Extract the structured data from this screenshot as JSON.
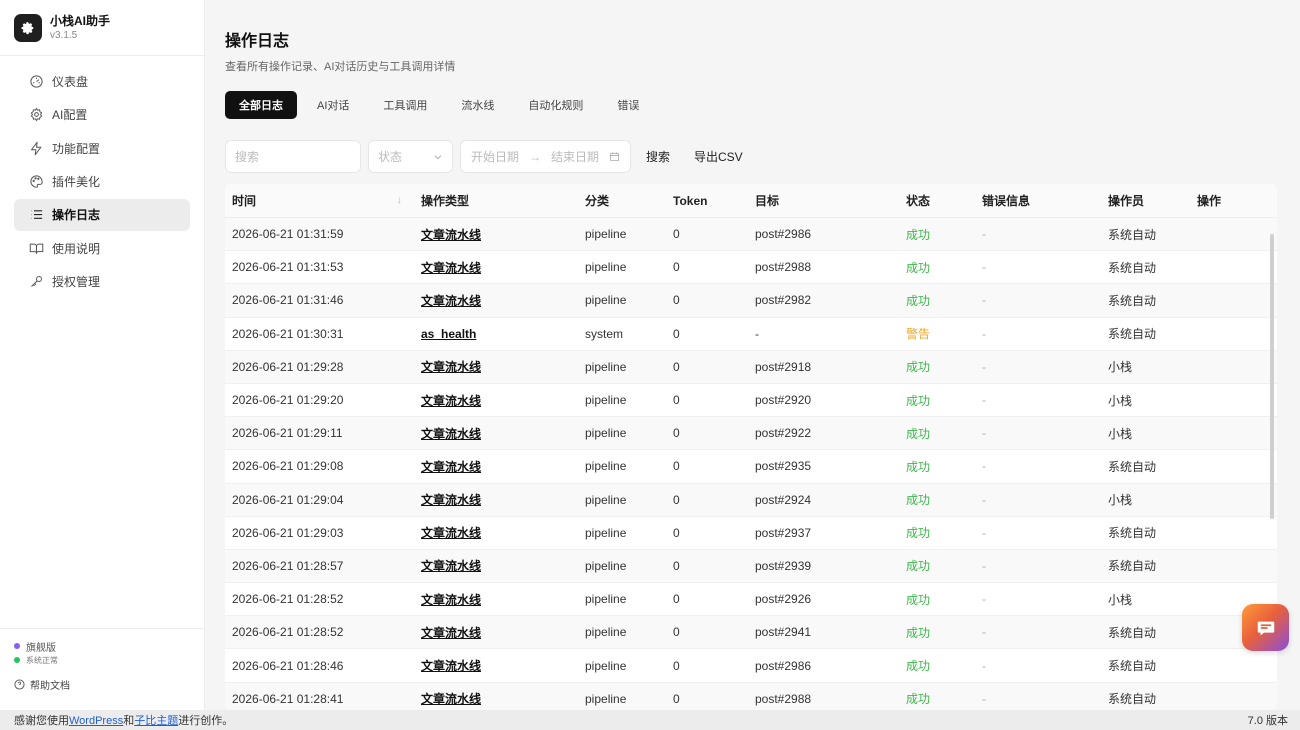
{
  "app": {
    "name": "小栈AI助手",
    "version": "v3.1.5"
  },
  "sidebar": {
    "items": [
      {
        "label": "仪表盘",
        "icon": "dashboard-icon"
      },
      {
        "label": "AI配置",
        "icon": "gear-icon"
      },
      {
        "label": "功能配置",
        "icon": "lightning-icon"
      },
      {
        "label": "插件美化",
        "icon": "palette-icon"
      },
      {
        "label": "操作日志",
        "icon": "list-icon",
        "active": true
      },
      {
        "label": "使用说明",
        "icon": "book-icon"
      },
      {
        "label": "授权管理",
        "icon": "key-icon"
      }
    ],
    "footer": {
      "edition": "旗舰版",
      "edition_color": "#8b5cf6",
      "status": "系统正常",
      "status_color": "#22c55e",
      "help": "帮助文档"
    }
  },
  "main": {
    "title": "操作日志",
    "subtitle": "查看所有操作记录、AI对话历史与工具调用详情",
    "tabs": [
      "全部日志",
      "AI对话",
      "工具调用",
      "流水线",
      "自动化规则",
      "错误"
    ],
    "active_tab": 0,
    "filters": {
      "search_placeholder": "搜索",
      "status_placeholder": "状态",
      "start_date": "开始日期",
      "end_date": "结束日期",
      "arrow": "→",
      "search_button": "搜索",
      "export_button": "导出CSV"
    }
  },
  "table": {
    "headers": [
      "时间",
      "操作类型",
      "分类",
      "Token",
      "目标",
      "状态",
      "错误信息",
      "操作员",
      "操作"
    ],
    "sort_glyph": "↓",
    "rows": [
      {
        "time": "2026-06-21 01:31:59",
        "type": "文章流水线",
        "cat": "pipeline",
        "token": "0",
        "target": "post#2986",
        "status": "成功",
        "status_kind": "ok",
        "err": "-",
        "op": "系统自动"
      },
      {
        "time": "2026-06-21 01:31:53",
        "type": "文章流水线",
        "cat": "pipeline",
        "token": "0",
        "target": "post#2988",
        "status": "成功",
        "status_kind": "ok",
        "err": "-",
        "op": "系统自动"
      },
      {
        "time": "2026-06-21 01:31:46",
        "type": "文章流水线",
        "cat": "pipeline",
        "token": "0",
        "target": "post#2982",
        "status": "成功",
        "status_kind": "ok",
        "err": "-",
        "op": "系统自动"
      },
      {
        "time": "2026-06-21 01:30:31",
        "type": "as_health",
        "cat": "system",
        "token": "0",
        "target": "-",
        "status": "警告",
        "status_kind": "warn",
        "err": "-",
        "op": "系统自动"
      },
      {
        "time": "2026-06-21 01:29:28",
        "type": "文章流水线",
        "cat": "pipeline",
        "token": "0",
        "target": "post#2918",
        "status": "成功",
        "status_kind": "ok",
        "err": "-",
        "op": "小栈"
      },
      {
        "time": "2026-06-21 01:29:20",
        "type": "文章流水线",
        "cat": "pipeline",
        "token": "0",
        "target": "post#2920",
        "status": "成功",
        "status_kind": "ok",
        "err": "-",
        "op": "小栈"
      },
      {
        "time": "2026-06-21 01:29:11",
        "type": "文章流水线",
        "cat": "pipeline",
        "token": "0",
        "target": "post#2922",
        "status": "成功",
        "status_kind": "ok",
        "err": "-",
        "op": "小栈"
      },
      {
        "time": "2026-06-21 01:29:08",
        "type": "文章流水线",
        "cat": "pipeline",
        "token": "0",
        "target": "post#2935",
        "status": "成功",
        "status_kind": "ok",
        "err": "-",
        "op": "系统自动"
      },
      {
        "time": "2026-06-21 01:29:04",
        "type": "文章流水线",
        "cat": "pipeline",
        "token": "0",
        "target": "post#2924",
        "status": "成功",
        "status_kind": "ok",
        "err": "-",
        "op": "小栈"
      },
      {
        "time": "2026-06-21 01:29:03",
        "type": "文章流水线",
        "cat": "pipeline",
        "token": "0",
        "target": "post#2937",
        "status": "成功",
        "status_kind": "ok",
        "err": "-",
        "op": "系统自动"
      },
      {
        "time": "2026-06-21 01:28:57",
        "type": "文章流水线",
        "cat": "pipeline",
        "token": "0",
        "target": "post#2939",
        "status": "成功",
        "status_kind": "ok",
        "err": "-",
        "op": "系统自动"
      },
      {
        "time": "2026-06-21 01:28:52",
        "type": "文章流水线",
        "cat": "pipeline",
        "token": "0",
        "target": "post#2926",
        "status": "成功",
        "status_kind": "ok",
        "err": "-",
        "op": "小栈"
      },
      {
        "time": "2026-06-21 01:28:52",
        "type": "文章流水线",
        "cat": "pipeline",
        "token": "0",
        "target": "post#2941",
        "status": "成功",
        "status_kind": "ok",
        "err": "-",
        "op": "系统自动"
      },
      {
        "time": "2026-06-21 01:28:46",
        "type": "文章流水线",
        "cat": "pipeline",
        "token": "0",
        "target": "post#2986",
        "status": "成功",
        "status_kind": "ok",
        "err": "-",
        "op": "系统自动"
      },
      {
        "time": "2026-06-21 01:28:41",
        "type": "文章流水线",
        "cat": "pipeline",
        "token": "0",
        "target": "post#2988",
        "status": "成功",
        "status_kind": "ok",
        "err": "-",
        "op": "系统自动"
      }
    ]
  },
  "footer": {
    "prefix": "感谢您使用",
    "link1": "WordPress",
    "mid": "和",
    "link2": "子比主题",
    "suffix": "进行创作。",
    "version": "7.0 版本"
  },
  "fab": {
    "icon": "chat-icon"
  }
}
